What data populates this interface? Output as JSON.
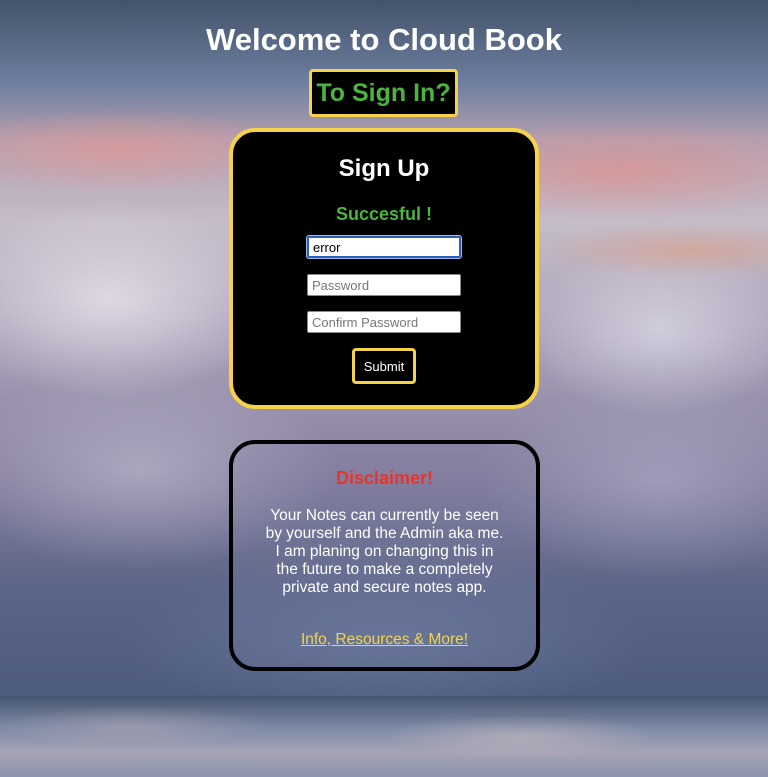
{
  "header": {
    "title": "Welcome to Cloud Book",
    "signin_label": "To Sign In?"
  },
  "signup": {
    "title": "Sign Up",
    "status": "Succesful !",
    "username_value": "error",
    "password_placeholder": "Password",
    "confirm_placeholder": "Confirm Password",
    "submit_label": "Submit"
  },
  "disclaimer": {
    "title": "Disclaimer!",
    "text": "Your Notes can currently be seen by yourself and the Admin aka me. I am planing on changing this in the future to make a completely private and secure notes app.",
    "link_label": "Info, Resources & More!"
  },
  "colors": {
    "accent_yellow": "#f5d24a",
    "success_green": "#4bb33e",
    "warning_red": "#e8352c"
  }
}
